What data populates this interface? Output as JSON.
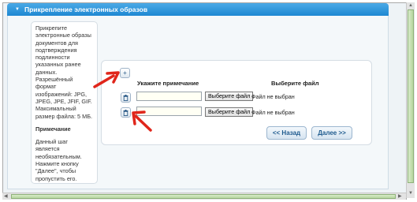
{
  "panel": {
    "title": "Прикрепление электронных образов"
  },
  "info": {
    "description": "Прикрепите электронные образы документов для подтверждения подлинности указанных ранее данных. Разрешённый формат изображений: JPG, JPEG, JPE, JFIF, GIF. Максимальный размер файла: 5 МБ.",
    "note_title": "Примечание",
    "note_text": "Данный шаг является необязательным. Нажмите кнопку \"Далее\", чтобы пропустить его."
  },
  "upload": {
    "add_symbol": "+",
    "delete_symbol": "🗑",
    "col_note": "Укажите примечание",
    "col_file": "Выберите файл",
    "rows": [
      {
        "note_value": "",
        "choose_label": "Выберите файл",
        "status": "Файл не выбран"
      },
      {
        "note_value": "",
        "choose_label": "Выберите файл",
        "status": "Файл не выбран"
      }
    ]
  },
  "nav": {
    "back_label": "<< Назад",
    "next_label": "Далее >>"
  },
  "colors": {
    "header": "#1e88d2",
    "arrow": "#e0261b",
    "scrollbar": "#b6d69e"
  }
}
